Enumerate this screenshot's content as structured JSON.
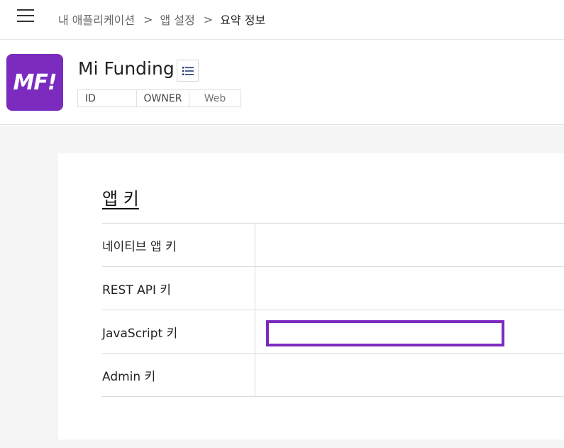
{
  "topbar": {
    "menu_icon": "hamburger-menu-icon",
    "breadcrumb": {
      "items": [
        "내 애플리케이션",
        "앱 설정"
      ],
      "separator": ">",
      "current": "요약 정보"
    }
  },
  "app": {
    "logo_text": "MF!",
    "logo_color": "#7b2cbf",
    "name": "Mi Funding",
    "list_icon": "list-icon",
    "tags": {
      "id": "ID",
      "owner": "OWNER",
      "platform": "Web"
    }
  },
  "app_keys": {
    "title": "앱 키",
    "rows": [
      {
        "label": "네이티브 앱 키",
        "value": ""
      },
      {
        "label": "REST API 키",
        "value": ""
      },
      {
        "label": "JavaScript 키",
        "value": "",
        "highlighted": true
      },
      {
        "label": "Admin 키",
        "value": ""
      }
    ],
    "highlight_color": "#7b2cbf"
  }
}
